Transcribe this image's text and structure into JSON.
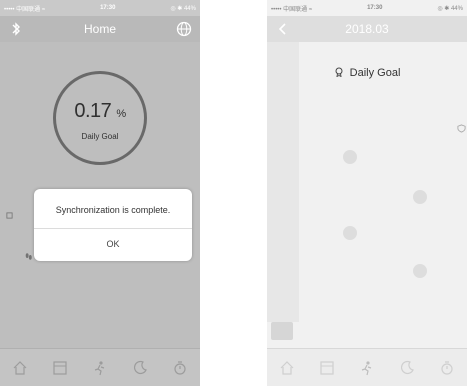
{
  "left": {
    "status": {
      "carrier": "••••• 中国联通 ≈",
      "time": "17:30",
      "battery": "◎ ✱ 44%"
    },
    "nav": {
      "title": "Home",
      "left_icon": "bluetooth-icon",
      "right_icon": "globe-icon"
    },
    "goal": {
      "value": "0.17",
      "unit": "%",
      "label": "Daily Goal"
    },
    "dialog": {
      "message": "Synchronization is complete.",
      "ok_label": "OK"
    },
    "tabs": [
      "home-icon",
      "data-icon",
      "sport-icon",
      "sleep-icon",
      "settings-icon"
    ]
  },
  "right": {
    "status": {
      "carrier": "••••• 中国联通 ≈",
      "time": "17:30",
      "battery": "◎ ✱ 44%"
    },
    "nav": {
      "title": "2018.03",
      "left_icon": "back-chevron-icon"
    },
    "goal": {
      "label": "Daily Goal"
    },
    "tabs": [
      "home-icon",
      "data-icon",
      "sport-icon",
      "sleep-icon",
      "settings-icon"
    ]
  },
  "colors": {
    "ring": "#6f6f6f",
    "left_bg": "#c9c9c9",
    "right_bg": "#f1f1f1"
  }
}
